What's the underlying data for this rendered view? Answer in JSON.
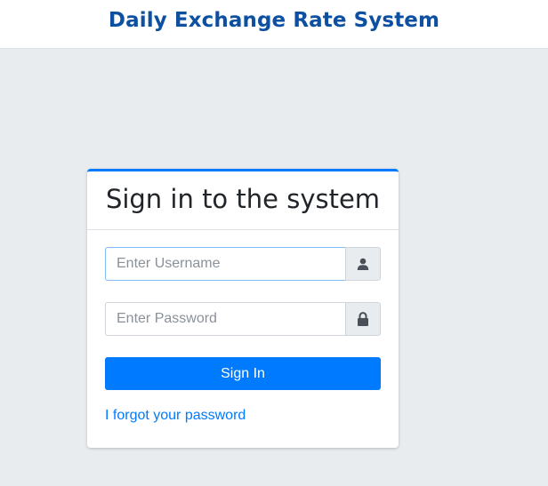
{
  "header": {
    "title": "Daily Exchange Rate System"
  },
  "login": {
    "title": "Sign in to the system",
    "username": {
      "value": "",
      "placeholder": "Enter Username",
      "icon": "user-icon"
    },
    "password": {
      "value": "",
      "placeholder": "Enter Password",
      "icon": "lock-icon"
    },
    "submit_label": "Sign In",
    "forgot_label": "I forgot your password"
  },
  "colors": {
    "brand_title": "#0d4fa0",
    "accent": "#007bff",
    "background": "#e9ecef"
  }
}
